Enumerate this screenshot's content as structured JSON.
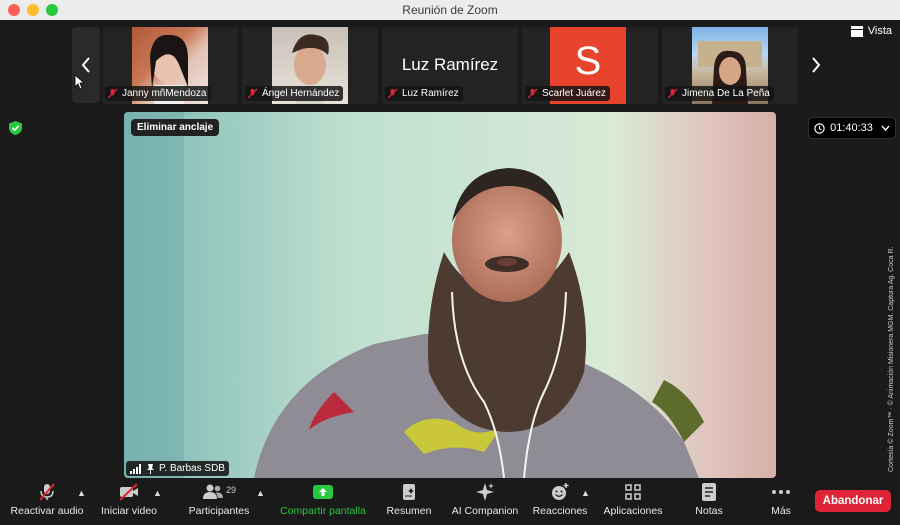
{
  "window": {
    "title": "Reunión de Zoom"
  },
  "gallery": {
    "participants": [
      {
        "name": "Janny mñMendoza",
        "type": "photo"
      },
      {
        "name": "Ángel Hernández",
        "type": "photo"
      },
      {
        "name": "Luz Ramírez",
        "type": "text",
        "display_name": "Luz Ramírez"
      },
      {
        "name": "Scarlet Juárez",
        "type": "avatar",
        "initial": "S",
        "color": "#e8442d"
      },
      {
        "name": "Jimena De La Peña",
        "type": "photo"
      }
    ]
  },
  "view_button": {
    "label": "Vista"
  },
  "timer": {
    "value": "01:40:33"
  },
  "main_video": {
    "unpin_label": "Eliminar anclaje",
    "speaker_name": "P. Barbas SDB"
  },
  "credit": "Cortesía © Zoom™ · © Animación Misionera MGM. Captura Ag. Coca R.",
  "toolbar": {
    "unmute": "Reactivar audio",
    "start_video": "Iniciar video",
    "participants": "Participantes",
    "participants_count": "29",
    "share": "Compartir pantalla",
    "summary": "Resumen",
    "ai": "AI Companion",
    "reactions": "Reacciones",
    "apps": "Aplicaciones",
    "notes": "Notas",
    "more": "Más",
    "leave": "Abandonar"
  },
  "colors": {
    "share_green": "#28c840",
    "leave_red": "#e02437",
    "avatar_red": "#e8442d"
  }
}
